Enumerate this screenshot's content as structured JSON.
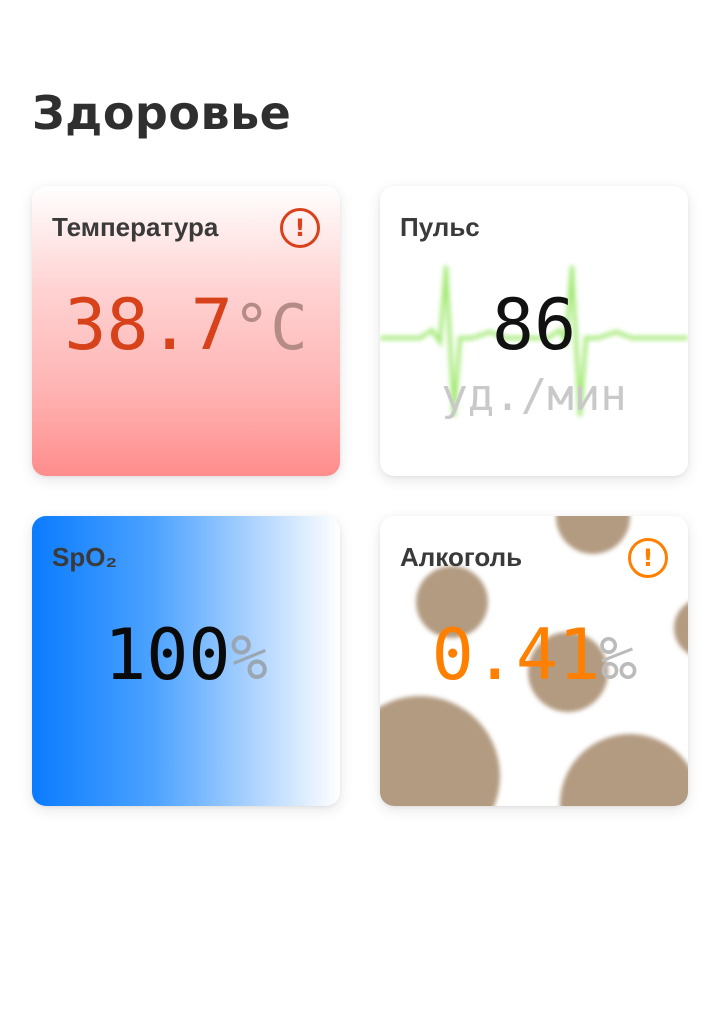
{
  "page": {
    "title": "Здоровье"
  },
  "cards": {
    "temperature": {
      "title": "Температура",
      "value": "38.7",
      "unit": "°C",
      "alert_icon": "alert-circle-icon"
    },
    "pulse": {
      "title": "Пульс",
      "value": "86",
      "unit": "уд./мин",
      "graph_icon": "heartbeat-icon"
    },
    "spo2": {
      "title": "SpO₂",
      "value": "100",
      "unit": "%"
    },
    "alcohol": {
      "title": "Алкоголь",
      "value": "0.41",
      "unit": "‰",
      "alert_icon": "alert-circle-icon"
    }
  },
  "colors": {
    "temperature_value": "#d8421b",
    "alcohol_value": "#ff8000",
    "spo2_gradient_start": "#0a7bff",
    "temperature_gradient_end": "#ff8c8c",
    "pulse_line": "#9be86a"
  }
}
